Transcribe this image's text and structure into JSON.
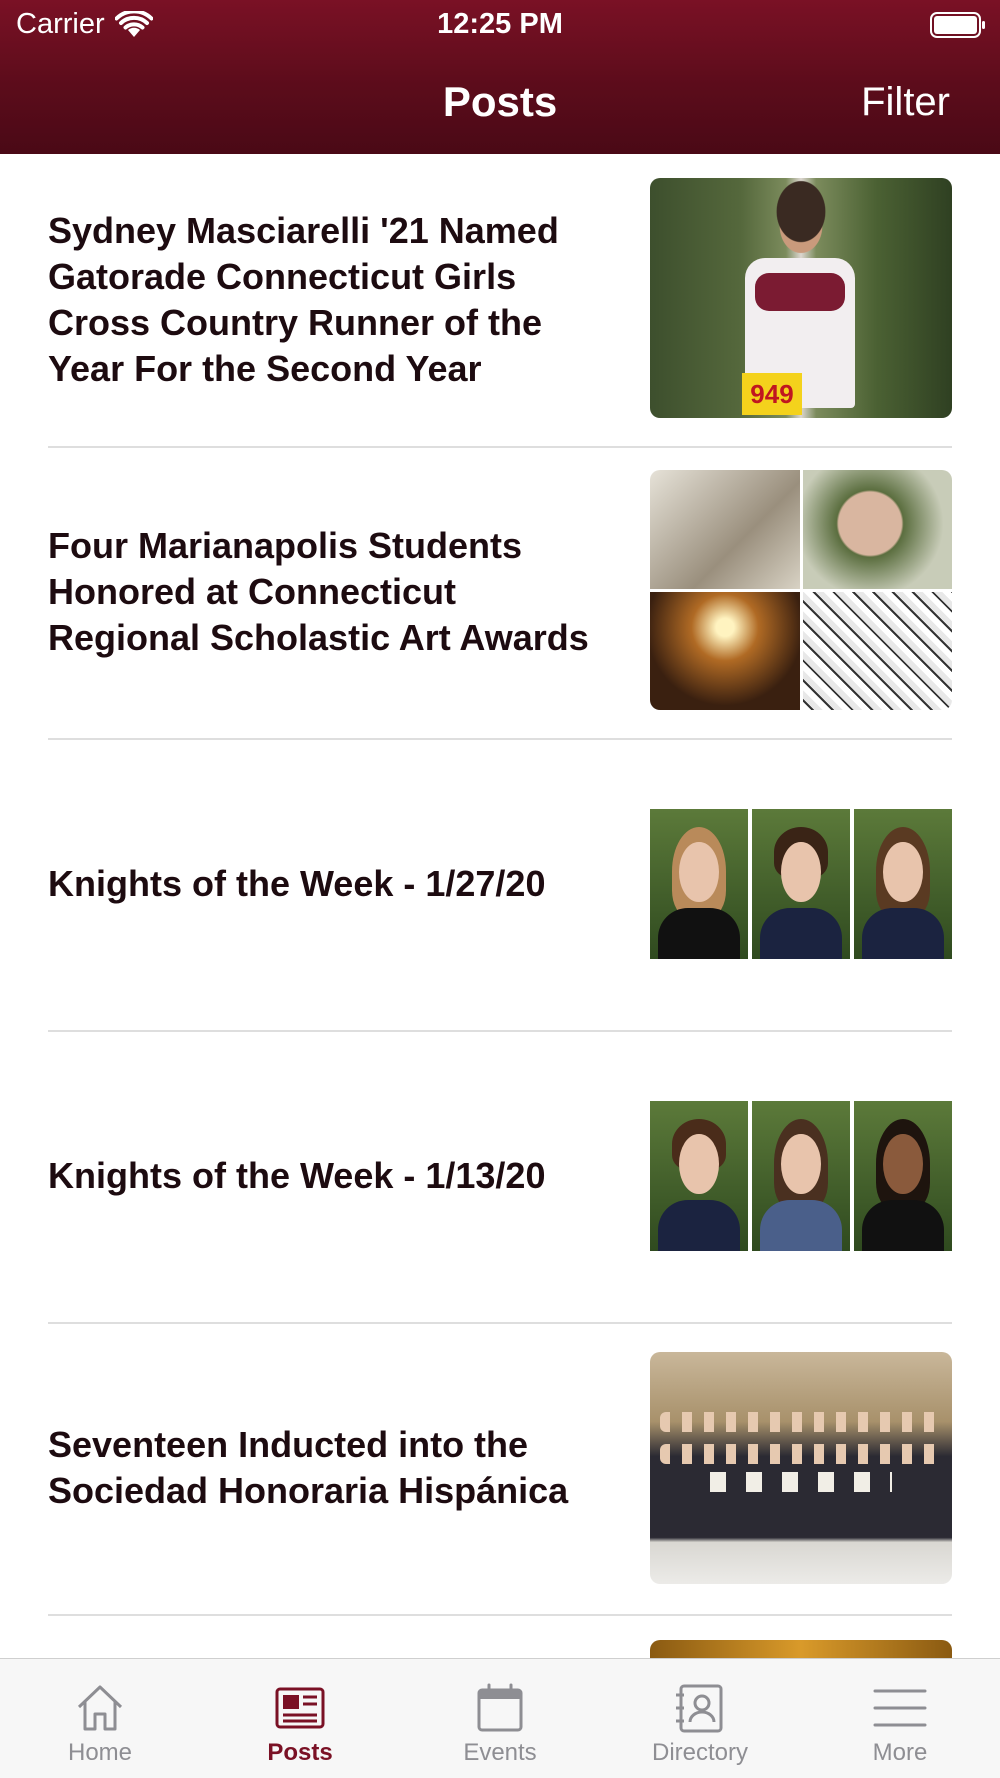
{
  "status_bar": {
    "carrier": "Carrier",
    "time": "12:25 PM"
  },
  "nav": {
    "title": "Posts",
    "filter_label": "Filter"
  },
  "posts": [
    {
      "title": "Sydney Masciarelli '21 Named Gatorade Connecticut Girls Cross Country Runner of the Year For the Second Year",
      "thumb_bib": "949"
    },
    {
      "title": "Four Marianapolis Students Honored at Connecticut Regional Scholastic Art Awards"
    },
    {
      "title": "Knights of the Week - 1/27/20"
    },
    {
      "title": "Knights of the Week - 1/13/20"
    },
    {
      "title": "Seventeen Inducted into the Sociedad Honoraria Hispánica"
    }
  ],
  "tabs": [
    {
      "label": "Home",
      "icon": "home-icon",
      "active": false
    },
    {
      "label": "Posts",
      "icon": "newspaper-icon",
      "active": true
    },
    {
      "label": "Events",
      "icon": "calendar-icon",
      "active": false
    },
    {
      "label": "Directory",
      "icon": "contact-book-icon",
      "active": false
    },
    {
      "label": "More",
      "icon": "hamburger-menu-icon",
      "active": false
    }
  ],
  "colors": {
    "brand": "#7a1125",
    "inactive_tab": "#8e8e93",
    "divider": "#dedede"
  }
}
